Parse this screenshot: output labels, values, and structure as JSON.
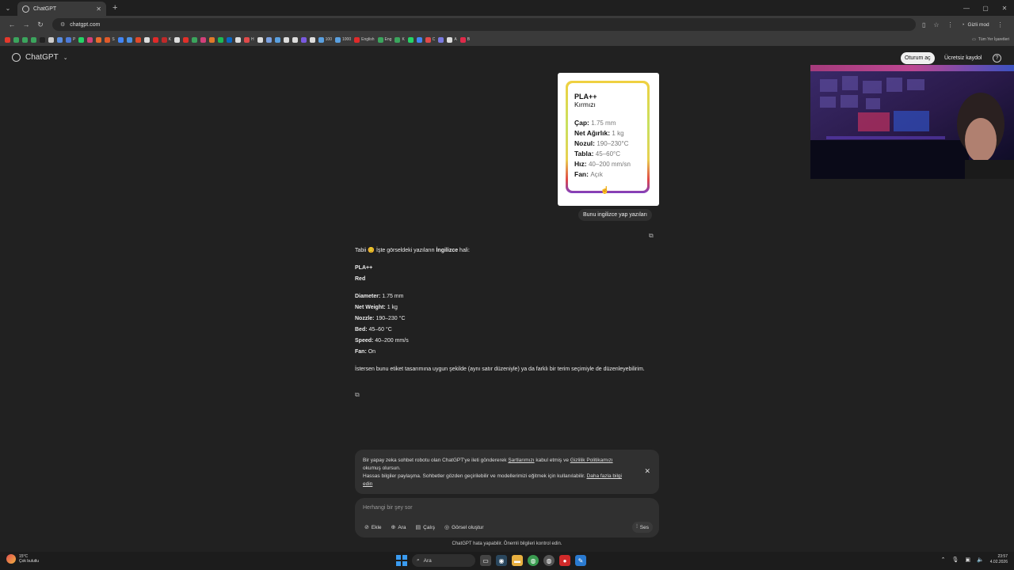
{
  "browser": {
    "tab_title": "ChatGPT",
    "url": "chatgpt.com",
    "profile": "Gizli mod",
    "bookmarks_all": "Tüm Yer İşaretleri",
    "bookmarks": [
      {
        "label": "",
        "color": "#e5392c"
      },
      {
        "label": "",
        "color": "#3ba55d"
      },
      {
        "label": "",
        "color": "#3ba55d"
      },
      {
        "label": "",
        "color": "#3ba55d"
      },
      {
        "label": "",
        "color": "#222222"
      },
      {
        "label": "",
        "color": "#cccccc"
      },
      {
        "label": "",
        "color": "#5a8de0"
      },
      {
        "label": "P",
        "color": "#4c7ad8"
      },
      {
        "label": "",
        "color": "#25d366"
      },
      {
        "label": "",
        "color": "#d3407a"
      },
      {
        "label": "",
        "color": "#e86b2c"
      },
      {
        "label": "S",
        "color": "#e05a2a"
      },
      {
        "label": "",
        "color": "#4285f4"
      },
      {
        "label": "",
        "color": "#4a90e2"
      },
      {
        "label": "",
        "color": "#e04a2a"
      },
      {
        "label": "",
        "color": "#dddddd"
      },
      {
        "label": "",
        "color": "#e02a2a"
      },
      {
        "label": "K",
        "color": "#c02a2a"
      },
      {
        "label": "",
        "color": "#dddddd"
      },
      {
        "label": "",
        "color": "#e0302a"
      },
      {
        "label": "",
        "color": "#3ba55d"
      },
      {
        "label": "",
        "color": "#d3407a"
      },
      {
        "label": "",
        "color": "#e07a2a"
      },
      {
        "label": "",
        "color": "#1db954"
      },
      {
        "label": "",
        "color": "#0a66c2"
      },
      {
        "label": "",
        "color": "#dddddd"
      },
      {
        "label": "H",
        "color": "#e04a4a"
      },
      {
        "label": "",
        "color": "#dddddd"
      },
      {
        "label": "",
        "color": "#7aa0e0"
      },
      {
        "label": "",
        "color": "#5aa0e0"
      },
      {
        "label": "",
        "color": "#dddddd"
      },
      {
        "label": "",
        "color": "#dddddd"
      },
      {
        "label": "",
        "color": "#7a5ae0"
      },
      {
        "label": "",
        "color": "#dddddd"
      },
      {
        "label": "100",
        "color": "#5aa0e0"
      },
      {
        "label": "1000",
        "color": "#5aa0e0"
      },
      {
        "label": "English",
        "color": "#e02a2a"
      },
      {
        "label": "Eng",
        "color": "#3ba55d"
      },
      {
        "label": "K",
        "color": "#3ba55d"
      },
      {
        "label": "",
        "color": "#25d366"
      },
      {
        "label": "",
        "color": "#4285f4"
      },
      {
        "label": "C",
        "color": "#e04a4a"
      },
      {
        "label": "",
        "color": "#7a7ae0"
      },
      {
        "label": "A",
        "color": "#dddddd"
      },
      {
        "label": "B",
        "color": "#e02a4a"
      }
    ]
  },
  "app": {
    "brand": "ChatGPT",
    "login": "Oturum aç",
    "signup": "Ücretsiz kaydol",
    "help": "?"
  },
  "label_image": {
    "title": "PLA++",
    "subtitle": "Kırmızı",
    "rows": [
      {
        "k": "Çap:",
        "v": "1.75 mm"
      },
      {
        "k": "Net Ağırlık:",
        "v": "1 kg"
      },
      {
        "k": "Nozul:",
        "v": "190–230°C"
      },
      {
        "k": "Tabla:",
        "v": "45–60°C"
      },
      {
        "k": "Hız:",
        "v": "40–200 mm/sn"
      },
      {
        "k": "Fan:",
        "v": "Açık"
      }
    ]
  },
  "user_message": "Bunu ingilizce yap yazıları",
  "assistant": {
    "intro_pre": "Tabii 😊 İşte görseldeki yazıların ",
    "intro_bold": "İngilizce",
    "intro_post": " hali:",
    "title": "PLA++",
    "subtitle": "Red",
    "rows": [
      {
        "k": "Diameter:",
        "v": " 1.75 mm"
      },
      {
        "k": "Net Weight:",
        "v": " 1 kg"
      },
      {
        "k": "Nozzle:",
        "v": " 190–230 °C"
      },
      {
        "k": "Bed:",
        "v": " 45–60 °C"
      },
      {
        "k": "Speed:",
        "v": " 40–200 mm/s"
      },
      {
        "k": "Fan:",
        "v": " On"
      }
    ],
    "outro": "İstersen bunu etiket tasarımına uygun şekilde (aynı satır düzeniyle) ya da farklı bir terim seçimiyle de düzenleyebilirim."
  },
  "notice": {
    "t1": "Bir yapay zeka sohbet robotu olan ChatGPT'ye ileti göndererek ",
    "link1": "Şartlarımızı",
    "t2": " kabul etmiş ve ",
    "link2": "Gizlilik Politikamızı",
    "t3": " okumuş olursun.",
    "t4": "Hassas bilgiler paylaşma. Sohbetler gözden geçirilebilir ve modellerimizi eğitmek için kullanılabilir. ",
    "link3": "Daha fazla bilgi edin"
  },
  "composer": {
    "placeholder": "Herhangi bir şey sor",
    "tools": [
      {
        "icon": "paperclip-icon",
        "glyph": "⊘",
        "label": "Ekle"
      },
      {
        "icon": "globe-icon",
        "glyph": "⊕",
        "label": "Ara"
      },
      {
        "icon": "book-icon",
        "glyph": "▤",
        "label": "Çalış"
      },
      {
        "icon": "image-icon",
        "glyph": "◎",
        "label": "Görsel oluştur"
      }
    ],
    "voice": "Ses"
  },
  "disclaimer": "ChatGPT hata yapabilir. Önemli bilgileri kontrol edin.",
  "taskbar": {
    "temp": "15°C",
    "weather": "Çok bulutlu",
    "search": "Ara",
    "time": "23:57",
    "date": "4.02.2026"
  }
}
